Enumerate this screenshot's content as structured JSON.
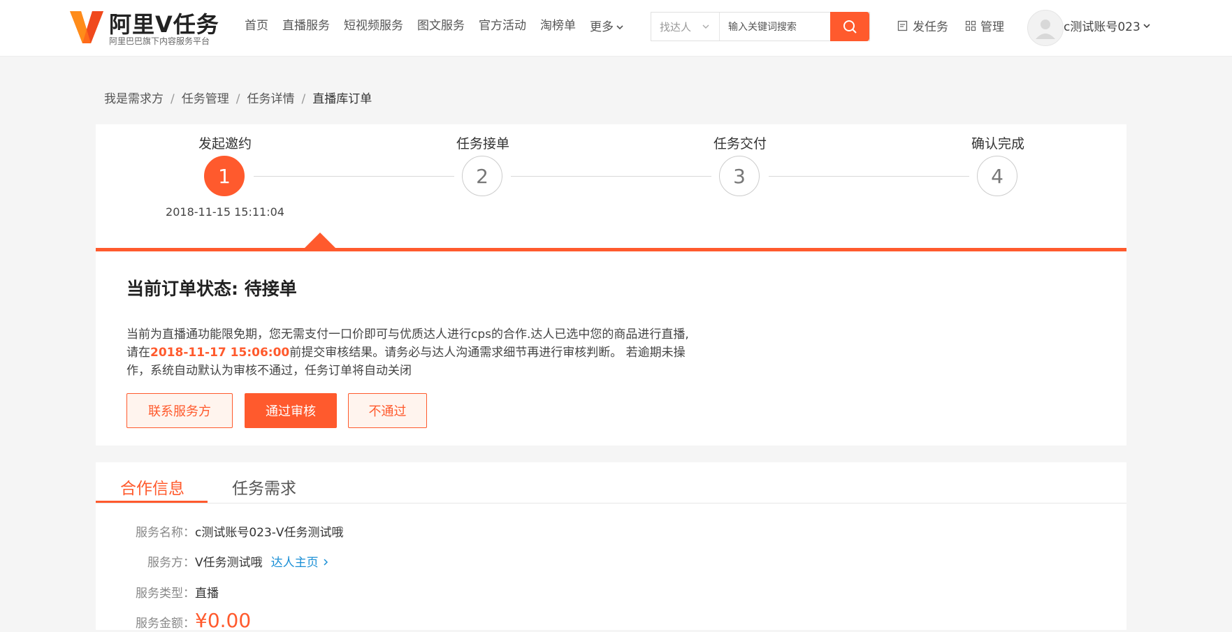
{
  "header": {
    "logo_title": "阿里V任务",
    "logo_subtitle": "阿里巴巴旗下内容服务平台",
    "nav": [
      "首页",
      "直播服务",
      "短视频服务",
      "图文服务",
      "官方活动",
      "淘榜单"
    ],
    "nav_more": "更多",
    "search_type": "找达人",
    "search_placeholder": "输入关键词搜索",
    "publish_task": "发任务",
    "manage": "管理",
    "account_name": "c测试账号023"
  },
  "breadcrumb": [
    "我是需求方",
    "任务管理",
    "任务详情",
    "直播库订单"
  ],
  "steps": [
    {
      "label": "发起邀约",
      "number": "1",
      "time": "2018-11-15 15:11:04"
    },
    {
      "label": "任务接单",
      "number": "2"
    },
    {
      "label": "任务交付",
      "number": "3"
    },
    {
      "label": "确认完成",
      "number": "4"
    }
  ],
  "status": {
    "title": "当前订单状态: 待接单",
    "desc_part1": "当前为直播通功能限免期，您无需支付一口价即可与优质达人进行cps的合作.达人已选中您的商品进行直播,请在",
    "deadline": "2018-11-17 15:06:00",
    "desc_part2": "前提交审核结果。请务必与达人沟通需求细节再进行审核判断。 若逾期未操作，系统自动默认为审核不通过，任务订单将自动关闭",
    "btn_contact": "联系服务方",
    "btn_approve": "通过审核",
    "btn_reject": "不通过"
  },
  "tabs": [
    "合作信息",
    "任务需求"
  ],
  "info": {
    "service_name_label": "服务名称：",
    "service_name": "c测试账号023-V任务测试哦",
    "provider_label": "服务方：",
    "provider": "V任务测试哦",
    "provider_link": "达人主页",
    "type_label": "服务类型：",
    "type": "直播",
    "amount_label": "服务金额：",
    "amount": "¥0.00"
  },
  "colors": {
    "accent": "#ff5a2d",
    "link": "#1a8fd6"
  }
}
